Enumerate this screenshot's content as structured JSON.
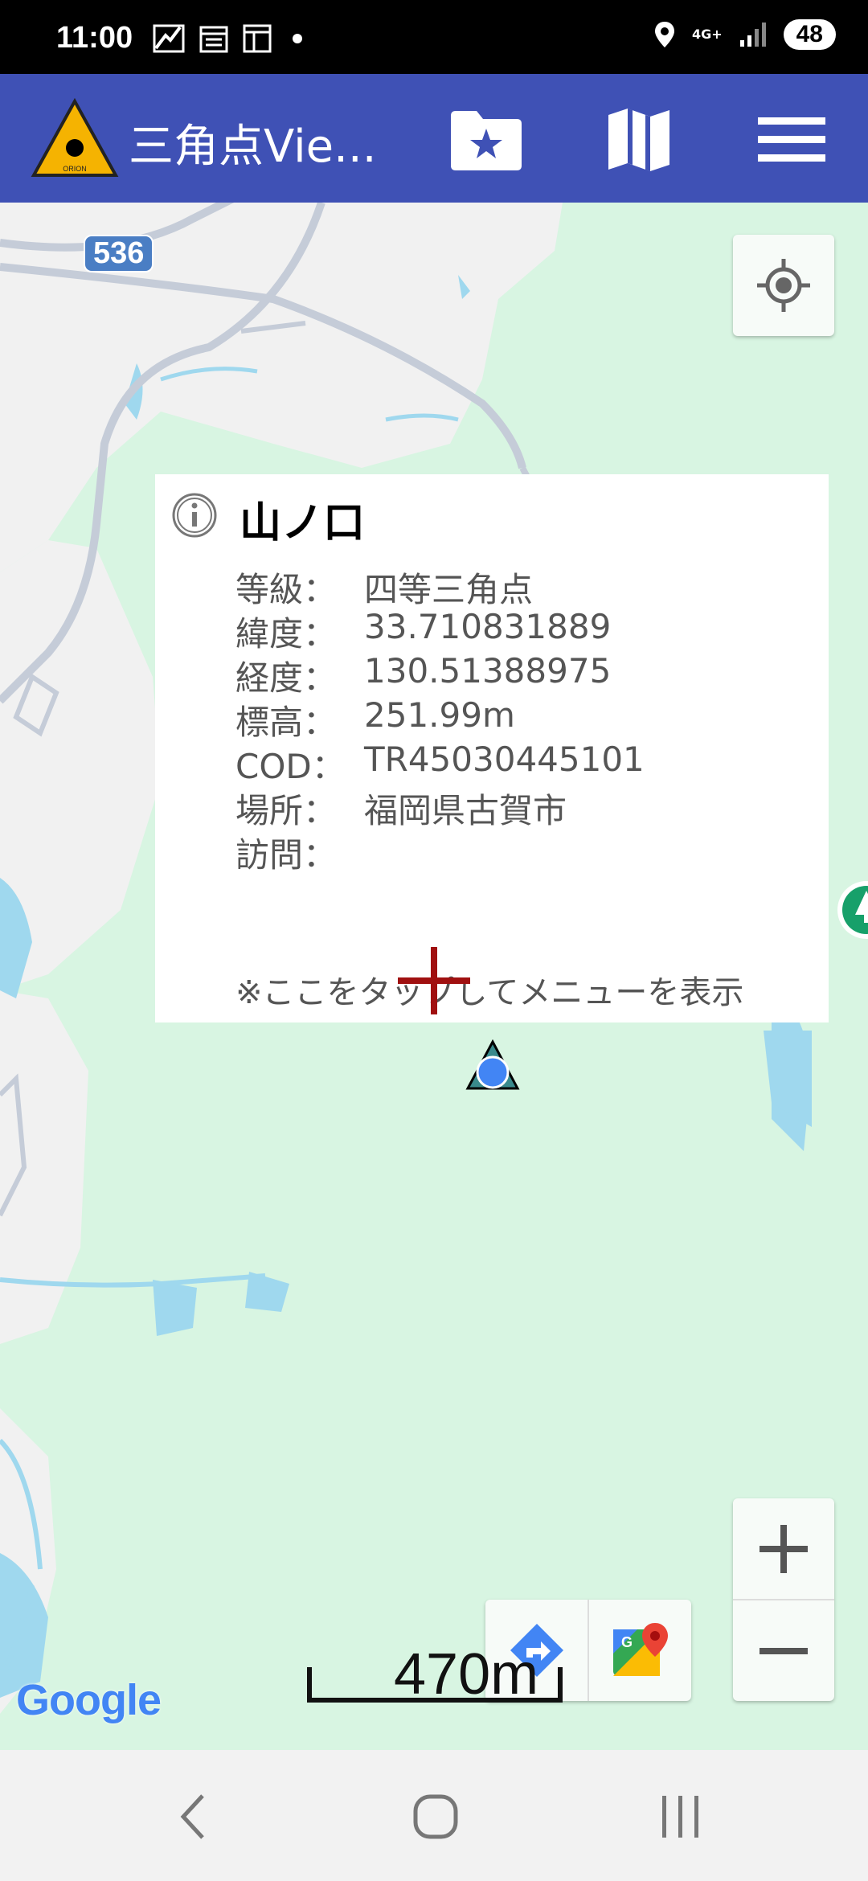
{
  "status_bar": {
    "time": "11:00",
    "network": "4G+",
    "battery": "48",
    "icons": [
      "missed-call-icon",
      "calendar-icon",
      "news-icon",
      "notification-dot-icon",
      "location-icon",
      "signal-icon"
    ]
  },
  "app_bar": {
    "title": "三角点Vie...",
    "logo_text": "ORION",
    "actions": [
      "folder-star-icon",
      "map-icon",
      "menu-icon"
    ],
    "colors": {
      "bar": "#3f51b5",
      "logo": "#f5b301"
    }
  },
  "map": {
    "road_label": "536",
    "scale_label": "470m",
    "google": "Google",
    "buttons": [
      "my-location-icon",
      "zoom-in-icon",
      "zoom-out-icon",
      "directions-icon",
      "google-maps-icon"
    ],
    "colors": {
      "land": "#d8f5e2",
      "urban": "#f0f0f0",
      "water": "#9fd8ee",
      "road": "#c5ccd8",
      "crosshair": "#a01010"
    }
  },
  "info_window": {
    "title": "山ノ口",
    "rows": [
      {
        "label": "等級：",
        "value": "四等三角点"
      },
      {
        "label": "緯度：",
        "value": "33.710831889"
      },
      {
        "label": "経度：",
        "value": "130.51388975"
      },
      {
        "label": "標高：",
        "value": "251.99m"
      },
      {
        "label": "COD：",
        "value": "TR45030445101"
      },
      {
        "label": "場所：",
        "value": "福岡県古賀市"
      },
      {
        "label": "訪問：",
        "value": ""
      }
    ],
    "hint": "※ここをタップしてメニューを表示"
  },
  "nav_bar": {
    "buttons": [
      "back-icon",
      "home-icon",
      "recents-icon"
    ]
  }
}
